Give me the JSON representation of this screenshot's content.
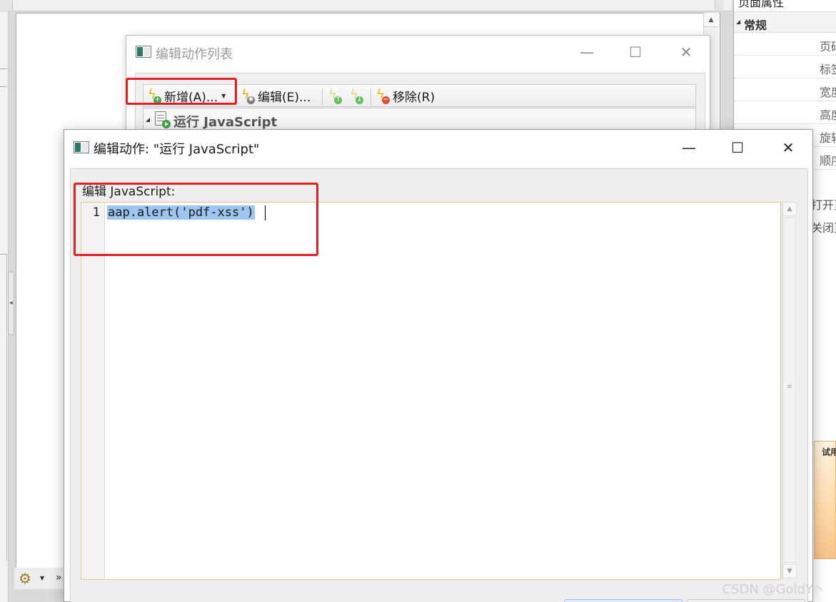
{
  "background": {
    "right_panel": {
      "title": "页面属性",
      "group": "常规",
      "rows": [
        "页码",
        "标签",
        "宽度",
        "高度",
        "旋转",
        "顺序"
      ],
      "extra": [
        "打开页面",
        "关闭页面"
      ],
      "ad_text": "试用"
    }
  },
  "action_list_dialog": {
    "title": "编辑动作列表",
    "toolbar": {
      "add": "新增(A)...",
      "edit": "编辑(E)...",
      "remove": "移除(R)"
    },
    "tree_item": "运行 JavaScript"
  },
  "edit_action_dialog": {
    "title": "编辑动作: \"运行 JavaScript\"",
    "label": "编辑 JavaScript:",
    "code_line_number": "1",
    "code": "aap.alert('pdf-xss')"
  },
  "watermark": "CSDN @GoldY丶",
  "colors": {
    "highlight_red": "#e62020",
    "selection_blue": "#9dc5ef",
    "editor_border": "#e3c88a"
  }
}
